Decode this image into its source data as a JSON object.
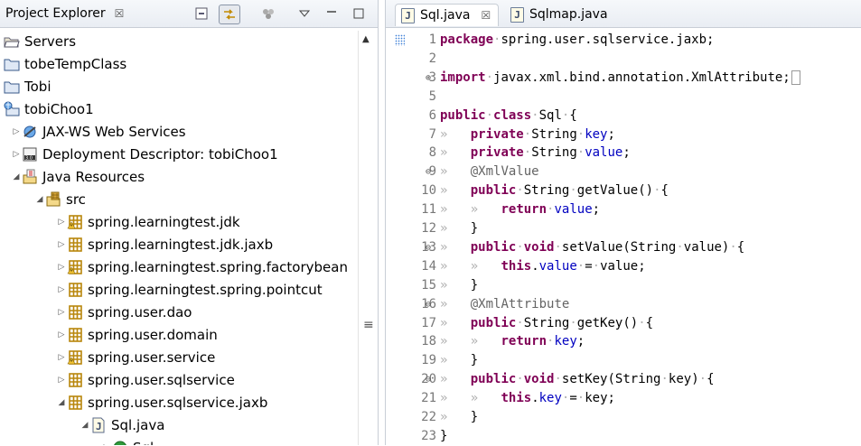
{
  "project_explorer": {
    "title": "Project Explorer",
    "close_glyph": "☒",
    "toolbar": [
      "collapse-all-icon",
      "link-with-editor-icon",
      "filter-icon",
      "view-menu-icon",
      "minimize-icon",
      "maximize-icon"
    ]
  },
  "tree": [
    {
      "label": "Servers",
      "icon": "folder-open-icon",
      "indent": 0,
      "toggle": ""
    },
    {
      "label": "tobeTempClass",
      "icon": "project-folder-icon",
      "indent": 0,
      "toggle": ""
    },
    {
      "label": "Tobi",
      "icon": "project-folder-icon",
      "indent": 0,
      "toggle": ""
    },
    {
      "label": "tobiChoo1",
      "icon": "web-project-icon",
      "indent": 0,
      "toggle": ""
    },
    {
      "label": "JAX-WS Web Services",
      "icon": "web-services-icon",
      "indent": 1,
      "toggle": "collapsed"
    },
    {
      "label": "Deployment Descriptor: tobiChoo1",
      "icon": "deployment-descriptor-icon",
      "indent": 1,
      "toggle": "collapsed"
    },
    {
      "label": "Java Resources",
      "icon": "java-resources-icon",
      "indent": 1,
      "toggle": "expanded"
    },
    {
      "label": "src",
      "icon": "source-folder-icon",
      "indent": 2,
      "toggle": "expanded"
    },
    {
      "label": "spring.learningtest.jdk",
      "icon": "package-warning-icon",
      "indent": 3,
      "toggle": "collapsed"
    },
    {
      "label": "spring.learningtest.jdk.jaxb",
      "icon": "package-icon",
      "indent": 3,
      "toggle": "collapsed"
    },
    {
      "label": "spring.learningtest.spring.factorybean",
      "icon": "package-warning-icon",
      "indent": 3,
      "toggle": "collapsed"
    },
    {
      "label": "spring.learningtest.spring.pointcut",
      "icon": "package-icon",
      "indent": 3,
      "toggle": "collapsed"
    },
    {
      "label": "spring.user.dao",
      "icon": "package-icon",
      "indent": 3,
      "toggle": "collapsed"
    },
    {
      "label": "spring.user.domain",
      "icon": "package-icon",
      "indent": 3,
      "toggle": "collapsed"
    },
    {
      "label": "spring.user.service",
      "icon": "package-warning-icon",
      "indent": 3,
      "toggle": "collapsed"
    },
    {
      "label": "spring.user.sqlservice",
      "icon": "package-icon",
      "indent": 3,
      "toggle": "collapsed"
    },
    {
      "label": "spring.user.sqlservice.jaxb",
      "icon": "package-icon",
      "indent": 3,
      "toggle": "expanded"
    },
    {
      "label": "Sql.java",
      "icon": "java-file-icon",
      "indent": 4,
      "toggle": "expanded"
    },
    {
      "label": "Sql",
      "icon": "class-icon",
      "indent": 5,
      "toggle": "collapsed"
    }
  ],
  "editor": {
    "tabs": [
      {
        "label": "Sql.java",
        "active": true,
        "close": "☒"
      },
      {
        "label": "Sqlmap.java",
        "active": false,
        "close": ""
      }
    ],
    "lines": [
      {
        "n": "1",
        "fold": "",
        "segs": [
          [
            "kw",
            "package"
          ],
          [
            "sp",
            "·"
          ],
          [
            "",
            "spring.user.sqlservice.jaxb;"
          ]
        ]
      },
      {
        "n": "2",
        "fold": "",
        "segs": []
      },
      {
        "n": "3",
        "fold": "⊕",
        "segs": [
          [
            "kw",
            "import"
          ],
          [
            "sp",
            "·"
          ],
          [
            "",
            "javax.xml.bind.annotation.XmlAttribute;"
          ]
        ],
        "box": true
      },
      {
        "n": "5",
        "fold": "",
        "segs": []
      },
      {
        "n": "6",
        "fold": "",
        "segs": [
          [
            "kw",
            "public"
          ],
          [
            "sp",
            "·"
          ],
          [
            "kw",
            "class"
          ],
          [
            "sp",
            "·"
          ],
          [
            "",
            "Sql"
          ],
          [
            "sp",
            "·"
          ],
          [
            "",
            "{"
          ]
        ]
      },
      {
        "n": "7",
        "fold": "",
        "guide": "»",
        "segs": [
          [
            "",
            "   "
          ],
          [
            "kw",
            "private"
          ],
          [
            "sp",
            "·"
          ],
          [
            "",
            "String"
          ],
          [
            "sp",
            "·"
          ],
          [
            "fld",
            "key"
          ],
          [
            "",
            ";"
          ]
        ]
      },
      {
        "n": "8",
        "fold": "",
        "guide": "»",
        "segs": [
          [
            "",
            "   "
          ],
          [
            "kw",
            "private"
          ],
          [
            "sp",
            "·"
          ],
          [
            "",
            "String"
          ],
          [
            "sp",
            "·"
          ],
          [
            "fld",
            "value"
          ],
          [
            "",
            ";"
          ]
        ]
      },
      {
        "n": "9",
        "fold": "⊖",
        "guide": "»",
        "segs": [
          [
            "",
            "   "
          ],
          [
            "ann",
            "@XmlValue"
          ]
        ]
      },
      {
        "n": "10",
        "fold": "",
        "guide": "»",
        "segs": [
          [
            "",
            "   "
          ],
          [
            "kw",
            "public"
          ],
          [
            "sp",
            "·"
          ],
          [
            "",
            "String"
          ],
          [
            "sp",
            "·"
          ],
          [
            "",
            "getValue()"
          ],
          [
            "sp",
            "·"
          ],
          [
            "",
            "{"
          ]
        ]
      },
      {
        "n": "11",
        "fold": "",
        "guide": "»",
        "segs": [
          [
            "",
            "   "
          ],
          [
            "sp",
            "»"
          ],
          [
            "",
            "   "
          ],
          [
            "kw",
            "return"
          ],
          [
            "sp",
            "·"
          ],
          [
            "fld",
            "value"
          ],
          [
            "",
            ";"
          ]
        ]
      },
      {
        "n": "12",
        "fold": "",
        "guide": "»",
        "segs": [
          [
            "",
            "   }"
          ]
        ]
      },
      {
        "n": "13",
        "fold": "⊖",
        "guide": "»",
        "segs": [
          [
            "",
            "   "
          ],
          [
            "kw",
            "public"
          ],
          [
            "sp",
            "·"
          ],
          [
            "kw",
            "void"
          ],
          [
            "sp",
            "·"
          ],
          [
            "",
            "setValue(String"
          ],
          [
            "sp",
            "·"
          ],
          [
            "",
            "value)"
          ],
          [
            "sp",
            "·"
          ],
          [
            "",
            "{"
          ]
        ]
      },
      {
        "n": "14",
        "fold": "",
        "guide": "»",
        "segs": [
          [
            "",
            "   "
          ],
          [
            "sp",
            "»"
          ],
          [
            "",
            "   "
          ],
          [
            "kw",
            "this"
          ],
          [
            "",
            "."
          ],
          [
            "fld",
            "value"
          ],
          [
            "sp",
            "·"
          ],
          [
            "",
            "="
          ],
          [
            "sp",
            "·"
          ],
          [
            "",
            "value;"
          ]
        ]
      },
      {
        "n": "15",
        "fold": "",
        "guide": "»",
        "segs": [
          [
            "",
            "   }"
          ]
        ]
      },
      {
        "n": "16",
        "fold": "⊖",
        "guide": "»",
        "segs": [
          [
            "",
            "   "
          ],
          [
            "ann",
            "@XmlAttribute"
          ]
        ]
      },
      {
        "n": "17",
        "fold": "",
        "guide": "»",
        "segs": [
          [
            "",
            "   "
          ],
          [
            "kw",
            "public"
          ],
          [
            "sp",
            "·"
          ],
          [
            "",
            "String"
          ],
          [
            "sp",
            "·"
          ],
          [
            "",
            "getKey()"
          ],
          [
            "sp",
            "·"
          ],
          [
            "",
            "{"
          ]
        ]
      },
      {
        "n": "18",
        "fold": "",
        "guide": "»",
        "segs": [
          [
            "",
            "   "
          ],
          [
            "sp",
            "»"
          ],
          [
            "",
            "   "
          ],
          [
            "kw",
            "return"
          ],
          [
            "sp",
            "·"
          ],
          [
            "fld",
            "key"
          ],
          [
            "",
            ";"
          ]
        ]
      },
      {
        "n": "19",
        "fold": "",
        "guide": "»",
        "segs": [
          [
            "",
            "   }"
          ]
        ]
      },
      {
        "n": "20",
        "fold": "⊖",
        "guide": "»",
        "segs": [
          [
            "",
            "   "
          ],
          [
            "kw",
            "public"
          ],
          [
            "sp",
            "·"
          ],
          [
            "kw",
            "void"
          ],
          [
            "sp",
            "·"
          ],
          [
            "",
            "setKey(String"
          ],
          [
            "sp",
            "·"
          ],
          [
            "",
            "key)"
          ],
          [
            "sp",
            "·"
          ],
          [
            "",
            "{"
          ]
        ]
      },
      {
        "n": "21",
        "fold": "",
        "guide": "»",
        "segs": [
          [
            "",
            "   "
          ],
          [
            "sp",
            "»"
          ],
          [
            "",
            "   "
          ],
          [
            "kw",
            "this"
          ],
          [
            "",
            "."
          ],
          [
            "fld",
            "key"
          ],
          [
            "sp",
            "·"
          ],
          [
            "",
            "="
          ],
          [
            "sp",
            "·"
          ],
          [
            "",
            "key;"
          ]
        ]
      },
      {
        "n": "22",
        "fold": "",
        "guide": "»",
        "segs": [
          [
            "",
            "   }"
          ]
        ]
      },
      {
        "n": "23",
        "fold": "",
        "segs": [
          [
            "",
            "}"
          ]
        ]
      }
    ]
  },
  "colors": {
    "keyword": "#7f0055",
    "field": "#0000c0",
    "annotation": "#646464",
    "package_icon": "#b8860b"
  }
}
